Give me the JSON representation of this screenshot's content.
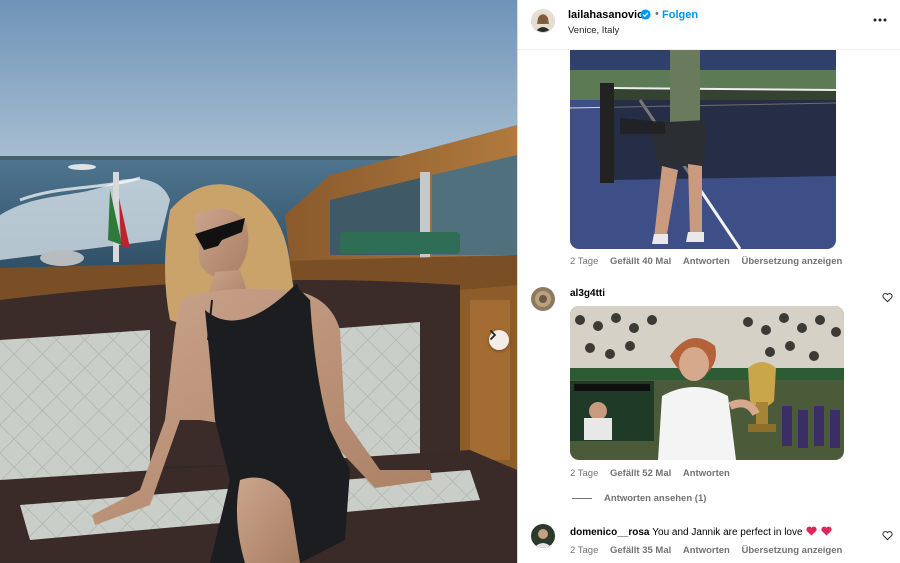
{
  "post": {
    "username": "lailahasanovic",
    "follow_label": "Folgen",
    "separator": "•",
    "location": "Venice, Italy",
    "more_icon": "more-options-icon",
    "verified_icon": "verified-badge-icon"
  },
  "photo": {
    "description_icon": "post-image",
    "next_icon": "chevron-right-icon"
  },
  "comments": [
    {
      "username": "",
      "media": "tennis-player-gif",
      "time": "2 Tage",
      "likes": "Gefällt 40 Mal",
      "reply": "Antworten",
      "translate": "Übersetzung anzeigen"
    },
    {
      "username": "al3g4tti",
      "media": "trophy-gif",
      "time": "2 Tage",
      "likes": "Gefällt 52 Mal",
      "reply": "Antworten",
      "view_replies": "Antworten ansehen (1)"
    },
    {
      "username": "domenico__rosa",
      "text": "You and Jannik are perfect in love",
      "time": "2 Tage",
      "likes": "Gefällt 35 Mal",
      "reply": "Antworten",
      "translate": "Übersetzung anzeigen"
    }
  ],
  "colors": {
    "link_blue": "#0095f6",
    "muted": "#737373",
    "heart_pink": "#e0245e"
  }
}
